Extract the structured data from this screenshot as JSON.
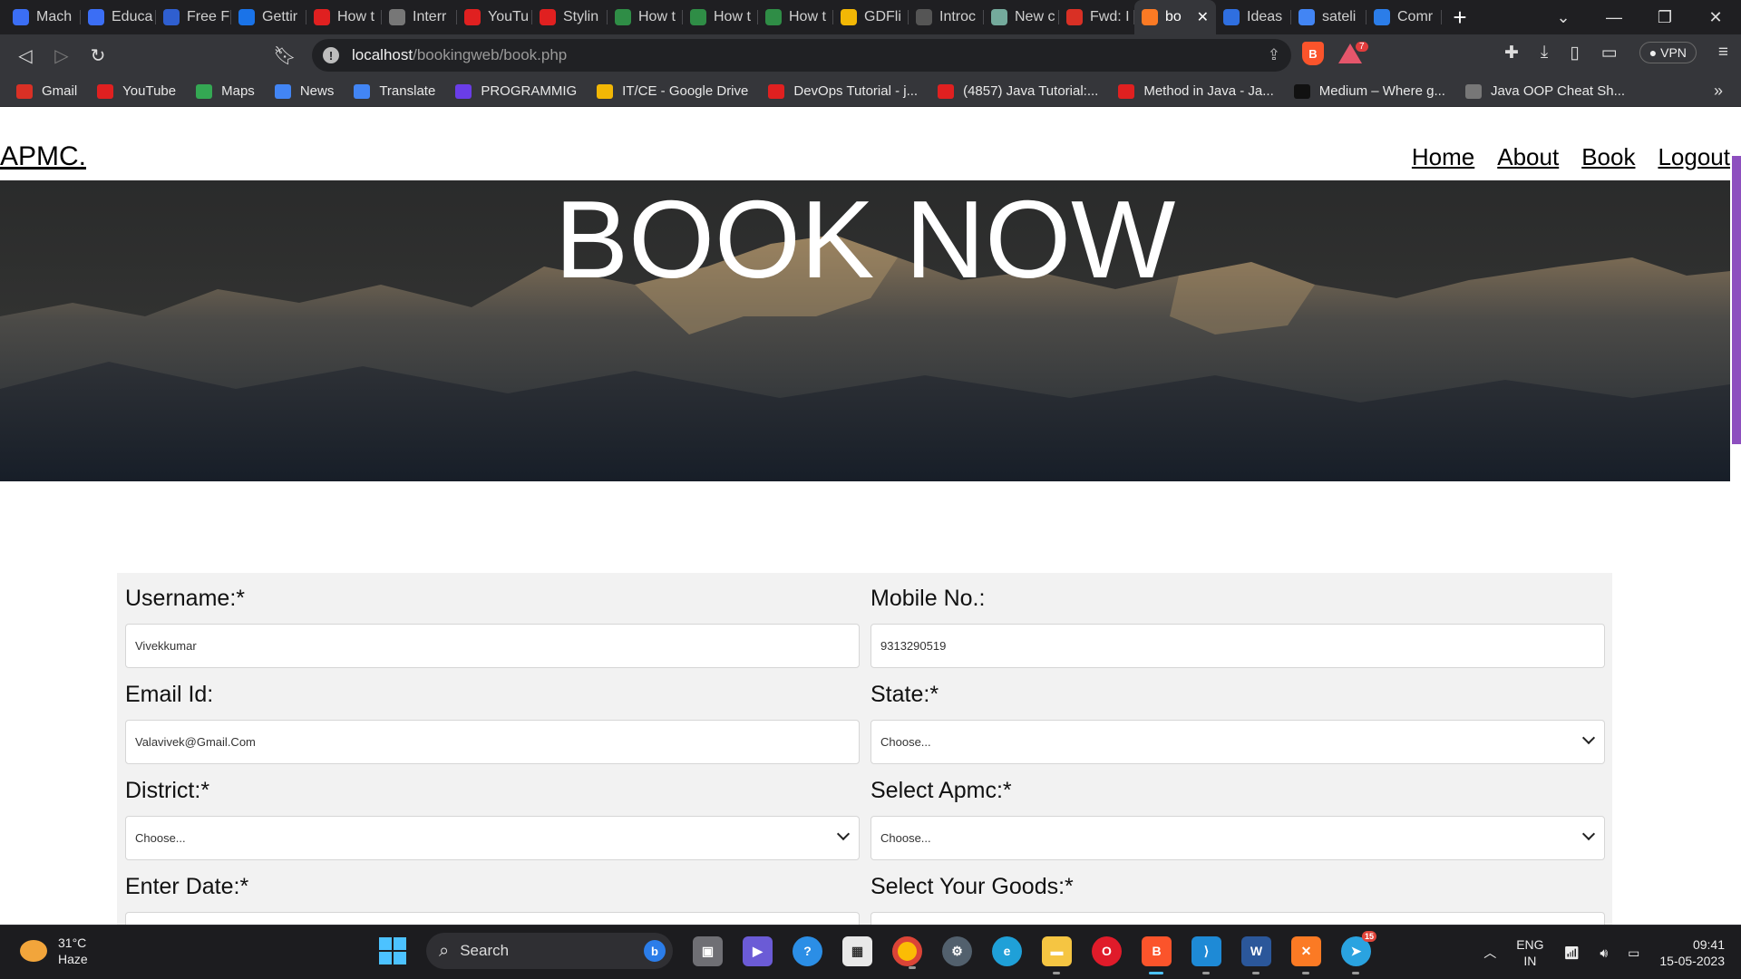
{
  "browser": {
    "tabs": [
      {
        "label": "Mach",
        "icon": "scrimba-icon",
        "color": "#3b6ef5"
      },
      {
        "label": "Educa",
        "icon": "scrimba-icon",
        "color": "#3b6ef5"
      },
      {
        "label": "Free F",
        "icon": "freecodecamp-icon",
        "color": "#2f5fd0"
      },
      {
        "label": "Gettir",
        "icon": "skype-icon",
        "color": "#1a73e8"
      },
      {
        "label": "How t",
        "icon": "youtube-icon",
        "color": "#e02020"
      },
      {
        "label": "Interr",
        "icon": "globe-icon",
        "color": "#777777"
      },
      {
        "label": "YouTu",
        "icon": "youtube-music-icon",
        "color": "#e02020"
      },
      {
        "label": "Stylin",
        "icon": "youtube-icon",
        "color": "#e02020"
      },
      {
        "label": "How t",
        "icon": "geeksforgeeks-icon",
        "color": "#2f8d46"
      },
      {
        "label": "How t",
        "icon": "geeksforgeeks-icon",
        "color": "#2f8d46"
      },
      {
        "label": "How t",
        "icon": "geeksforgeeks-icon",
        "color": "#2f8d46"
      },
      {
        "label": "GDFli",
        "icon": "google-drive-icon",
        "color": "#f2b705"
      },
      {
        "label": "Introc",
        "icon": "github-icon",
        "color": "#555555"
      },
      {
        "label": "New c",
        "icon": "chatgpt-icon",
        "color": "#74aa9c"
      },
      {
        "label": "Fwd: I",
        "icon": "gmail-icon",
        "color": "#d93025"
      },
      {
        "label": "bo",
        "icon": "xampp-icon",
        "color": "#fb7a24",
        "active": true
      },
      {
        "label": "Ideas",
        "icon": "ideas-icon",
        "color": "#2f6fe0"
      },
      {
        "label": "sateli",
        "icon": "google-icon",
        "color": "#4285f4"
      },
      {
        "label": "Comr",
        "icon": "w-icon",
        "color": "#2b7de9"
      }
    ],
    "url_host": "localhost",
    "url_path": "/bookingweb/book.php",
    "vpn_label": "VPN",
    "brave_badge": "7",
    "bookmarks": [
      {
        "label": "Gmail",
        "icon": "gmail-icon",
        "color": "#d93025"
      },
      {
        "label": "YouTube",
        "icon": "youtube-icon",
        "color": "#e02020"
      },
      {
        "label": "Maps",
        "icon": "maps-icon",
        "color": "#34a853"
      },
      {
        "label": "News",
        "icon": "news-icon",
        "color": "#4285f4"
      },
      {
        "label": "Translate",
        "icon": "translate-icon",
        "color": "#4285f4"
      },
      {
        "label": "PROGRAMMIG",
        "icon": "folder-icon",
        "color": "#6a3de8"
      },
      {
        "label": "IT/CE - Google Drive",
        "icon": "google-drive-icon",
        "color": "#f2b705"
      },
      {
        "label": "DevOps Tutorial - j...",
        "icon": "javatpoint-icon",
        "color": "#e02020"
      },
      {
        "label": "(4857) Java Tutorial:...",
        "icon": "youtube-icon",
        "color": "#e02020"
      },
      {
        "label": "Method in Java - Ja...",
        "icon": "javatpoint-icon",
        "color": "#e02020"
      },
      {
        "label": "Medium – Where g...",
        "icon": "medium-icon",
        "color": "#111111"
      },
      {
        "label": "Java OOP Cheat Sh...",
        "icon": "globe-icon",
        "color": "#777777"
      }
    ]
  },
  "site": {
    "logo": "APMC.",
    "nav": [
      "Home",
      "About",
      "Book",
      "Logout"
    ],
    "hero_title": "BOOK NOW"
  },
  "form": {
    "username_label": "Username:*",
    "username_value": "Vivekkumar",
    "mobile_label": "Mobile No.:",
    "mobile_value": "9313290519",
    "email_label": "Email Id:",
    "email_value": "Valavivek@Gmail.Com",
    "state_label": "State:*",
    "state_value": "Choose...",
    "district_label": "District:*",
    "district_value": "Choose...",
    "apmc_label": "Select Apmc:*",
    "apmc_value": "Choose...",
    "date_label": "Enter Date:*",
    "goods_label": "Select Your Goods:*"
  },
  "taskbar": {
    "temperature": "31°C",
    "weather": "Haze",
    "search_label": "Search",
    "lang": "ENG",
    "region": "IN",
    "time": "09:41",
    "date": "15-05-2023",
    "telegram_badge": "15"
  }
}
